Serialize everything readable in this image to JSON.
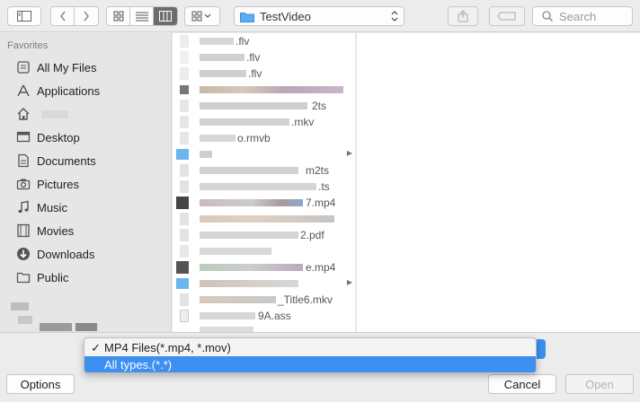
{
  "toolbar": {
    "path_label": "TestVideo",
    "search_placeholder": "Search"
  },
  "sidebar": {
    "heading": "Favorites",
    "items": [
      {
        "label": "All My Files",
        "icon": "all-files-icon"
      },
      {
        "label": "Applications",
        "icon": "applications-icon"
      },
      {
        "label": "",
        "icon": "home-icon"
      },
      {
        "label": "Desktop",
        "icon": "desktop-icon"
      },
      {
        "label": "Documents",
        "icon": "documents-icon"
      },
      {
        "label": "Pictures",
        "icon": "camera-icon"
      },
      {
        "label": "Music",
        "icon": "music-icon"
      },
      {
        "label": "Movies",
        "icon": "movies-icon"
      },
      {
        "label": "Downloads",
        "icon": "downloads-icon"
      },
      {
        "label": "Public",
        "icon": "public-icon"
      }
    ]
  },
  "files": [
    {
      "visible_text": ".flv",
      "folder": false
    },
    {
      "visible_text": ".flv",
      "folder": false
    },
    {
      "visible_text": ".flv",
      "folder": false
    },
    {
      "visible_text": "",
      "folder": false
    },
    {
      "visible_text": "2ts",
      "folder": false
    },
    {
      "visible_text": ".mkv",
      "folder": false
    },
    {
      "visible_text": "o.rmvb",
      "folder": false
    },
    {
      "visible_text": "",
      "folder": true
    },
    {
      "visible_text": "m2ts",
      "folder": false
    },
    {
      "visible_text": ".ts",
      "folder": false
    },
    {
      "visible_text": "7.mp4",
      "folder": false
    },
    {
      "visible_text": "",
      "folder": false
    },
    {
      "visible_text": "2.pdf",
      "folder": false
    },
    {
      "visible_text": "",
      "folder": false
    },
    {
      "visible_text": "e.mp4",
      "folder": false
    },
    {
      "visible_text": "",
      "folder": true
    },
    {
      "visible_text": "_Title6.mkv",
      "folder": false
    },
    {
      "visible_text": "9A.ass",
      "folder": false
    }
  ],
  "filetype_menu": {
    "options": [
      {
        "label": "MP4 Files(*.mp4, *.mov)",
        "checked": true,
        "highlighted": false
      },
      {
        "label": "All types.(*.*)",
        "checked": false,
        "highlighted": true
      }
    ],
    "check_mark": "✓"
  },
  "buttons": {
    "options": "Options",
    "cancel": "Cancel",
    "open": "Open"
  },
  "colors": {
    "accent": "#3d8ff0",
    "folder_blue": "#5aaef0"
  }
}
